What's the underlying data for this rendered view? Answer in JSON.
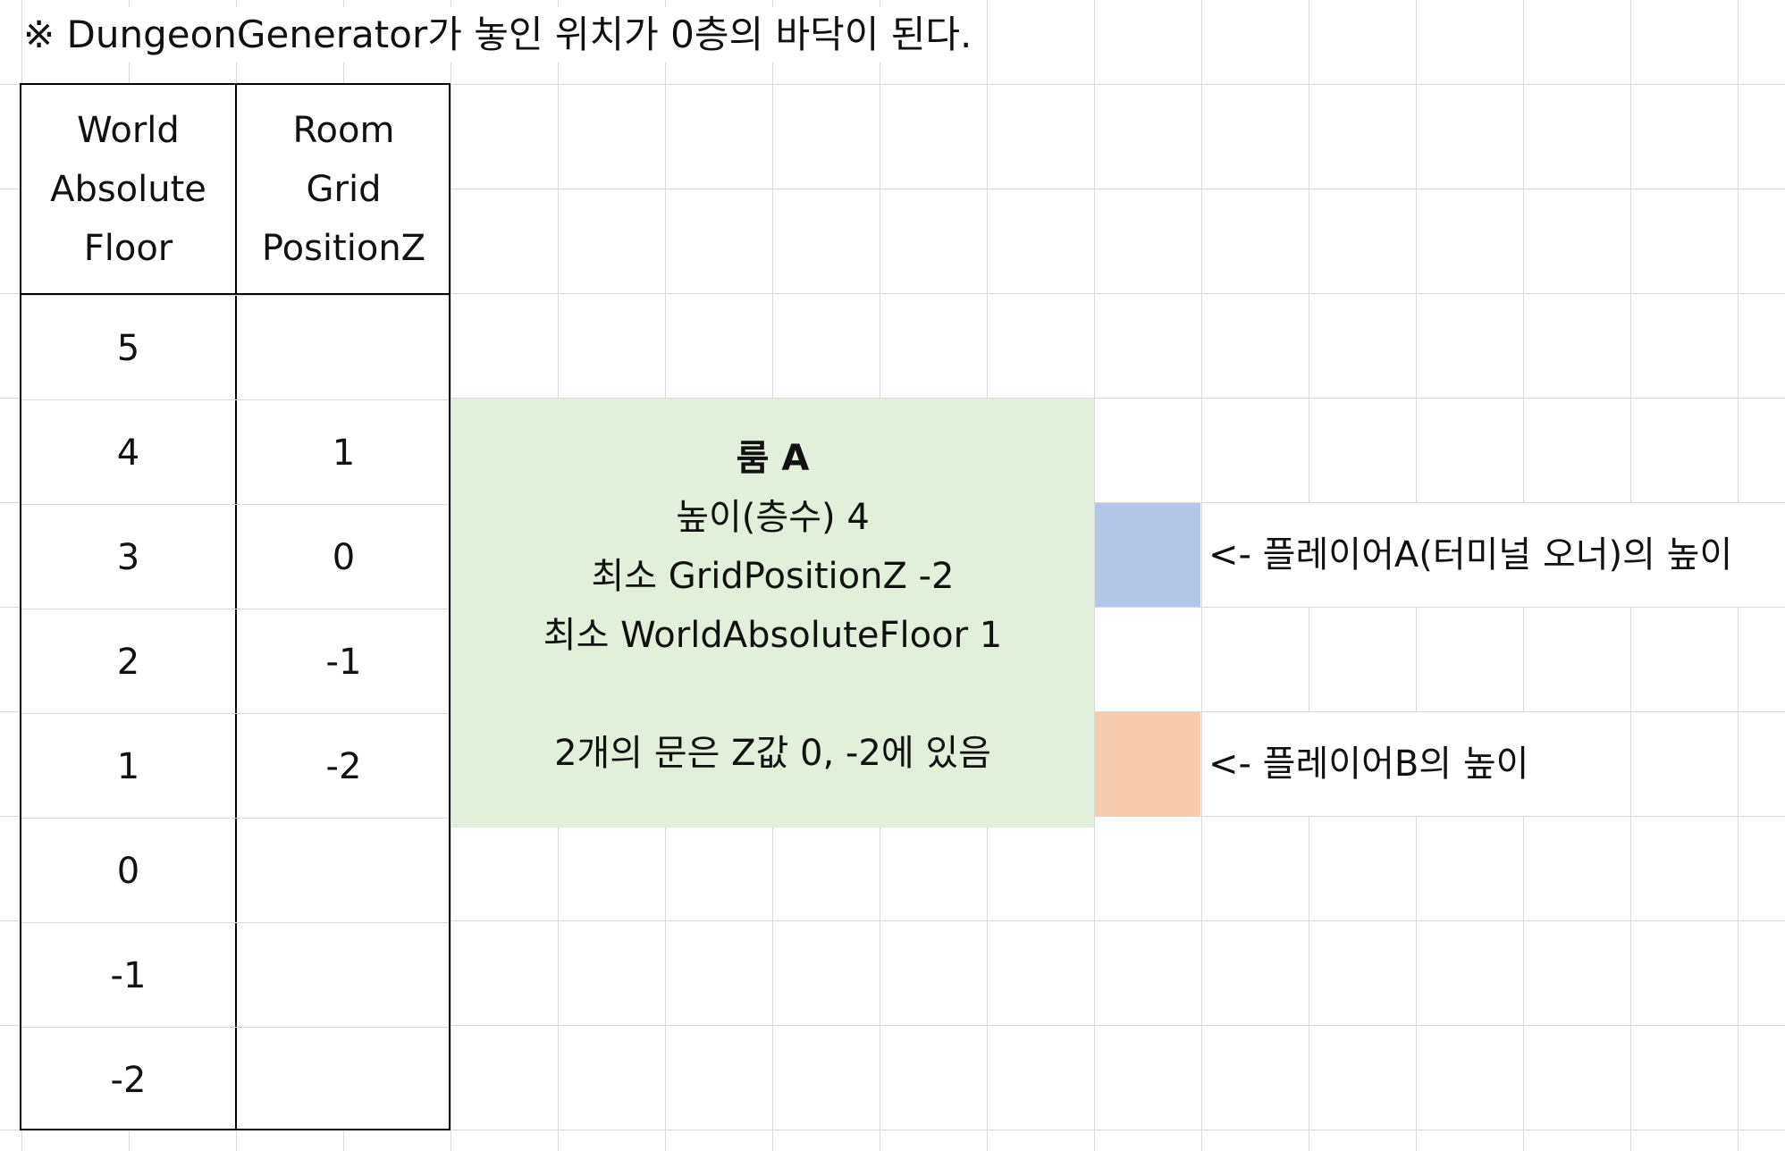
{
  "note": "※ DungeonGenerator가 놓인 위치가 0층의 바닥이 된다.",
  "table": {
    "headers": [
      [
        "World",
        "Absolute",
        "Floor"
      ],
      [
        "Room",
        "Grid",
        "PositionZ"
      ]
    ],
    "rows": [
      {
        "floor": "5",
        "gridz": ""
      },
      {
        "floor": "4",
        "gridz": "1"
      },
      {
        "floor": "3",
        "gridz": "0"
      },
      {
        "floor": "2",
        "gridz": "-1"
      },
      {
        "floor": "1",
        "gridz": "-2"
      },
      {
        "floor": "0",
        "gridz": ""
      },
      {
        "floor": "-1",
        "gridz": ""
      },
      {
        "floor": "-2",
        "gridz": ""
      }
    ]
  },
  "room": {
    "title": "룸 A",
    "lines": [
      "높이(층수) 4",
      "최소 GridPositionZ -2",
      "최소 WorldAbsoluteFloor 1"
    ],
    "doors": "2개의 문은 Z값 0, -2에 있음",
    "color": "#e2efda"
  },
  "players": {
    "a": {
      "label": "<- 플레이어A(터미널 오너)의 높이",
      "color": "#b4c6e7"
    },
    "b": {
      "label": "<- 플레이어B의 높이",
      "color": "#f8cbad"
    }
  }
}
